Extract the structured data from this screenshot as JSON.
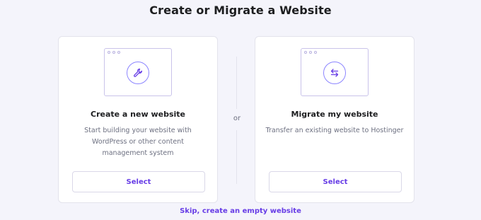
{
  "page": {
    "title": "Create or Migrate a Website",
    "or_label": "or",
    "skip_link": "Skip, create an empty website"
  },
  "cards": [
    {
      "title": "Create a new website",
      "description": "Start building your website with WordPress or other content management system",
      "button_label": "Select",
      "icon": "wrench-icon"
    },
    {
      "title": "Migrate my website",
      "description": "Transfer an existing website to Hostinger",
      "button_label": "Select",
      "icon": "swap-arrows-icon"
    }
  ],
  "colors": {
    "accent": "#673de6",
    "icon_stroke": "#8c85ff",
    "background": "#f4f4fb"
  }
}
